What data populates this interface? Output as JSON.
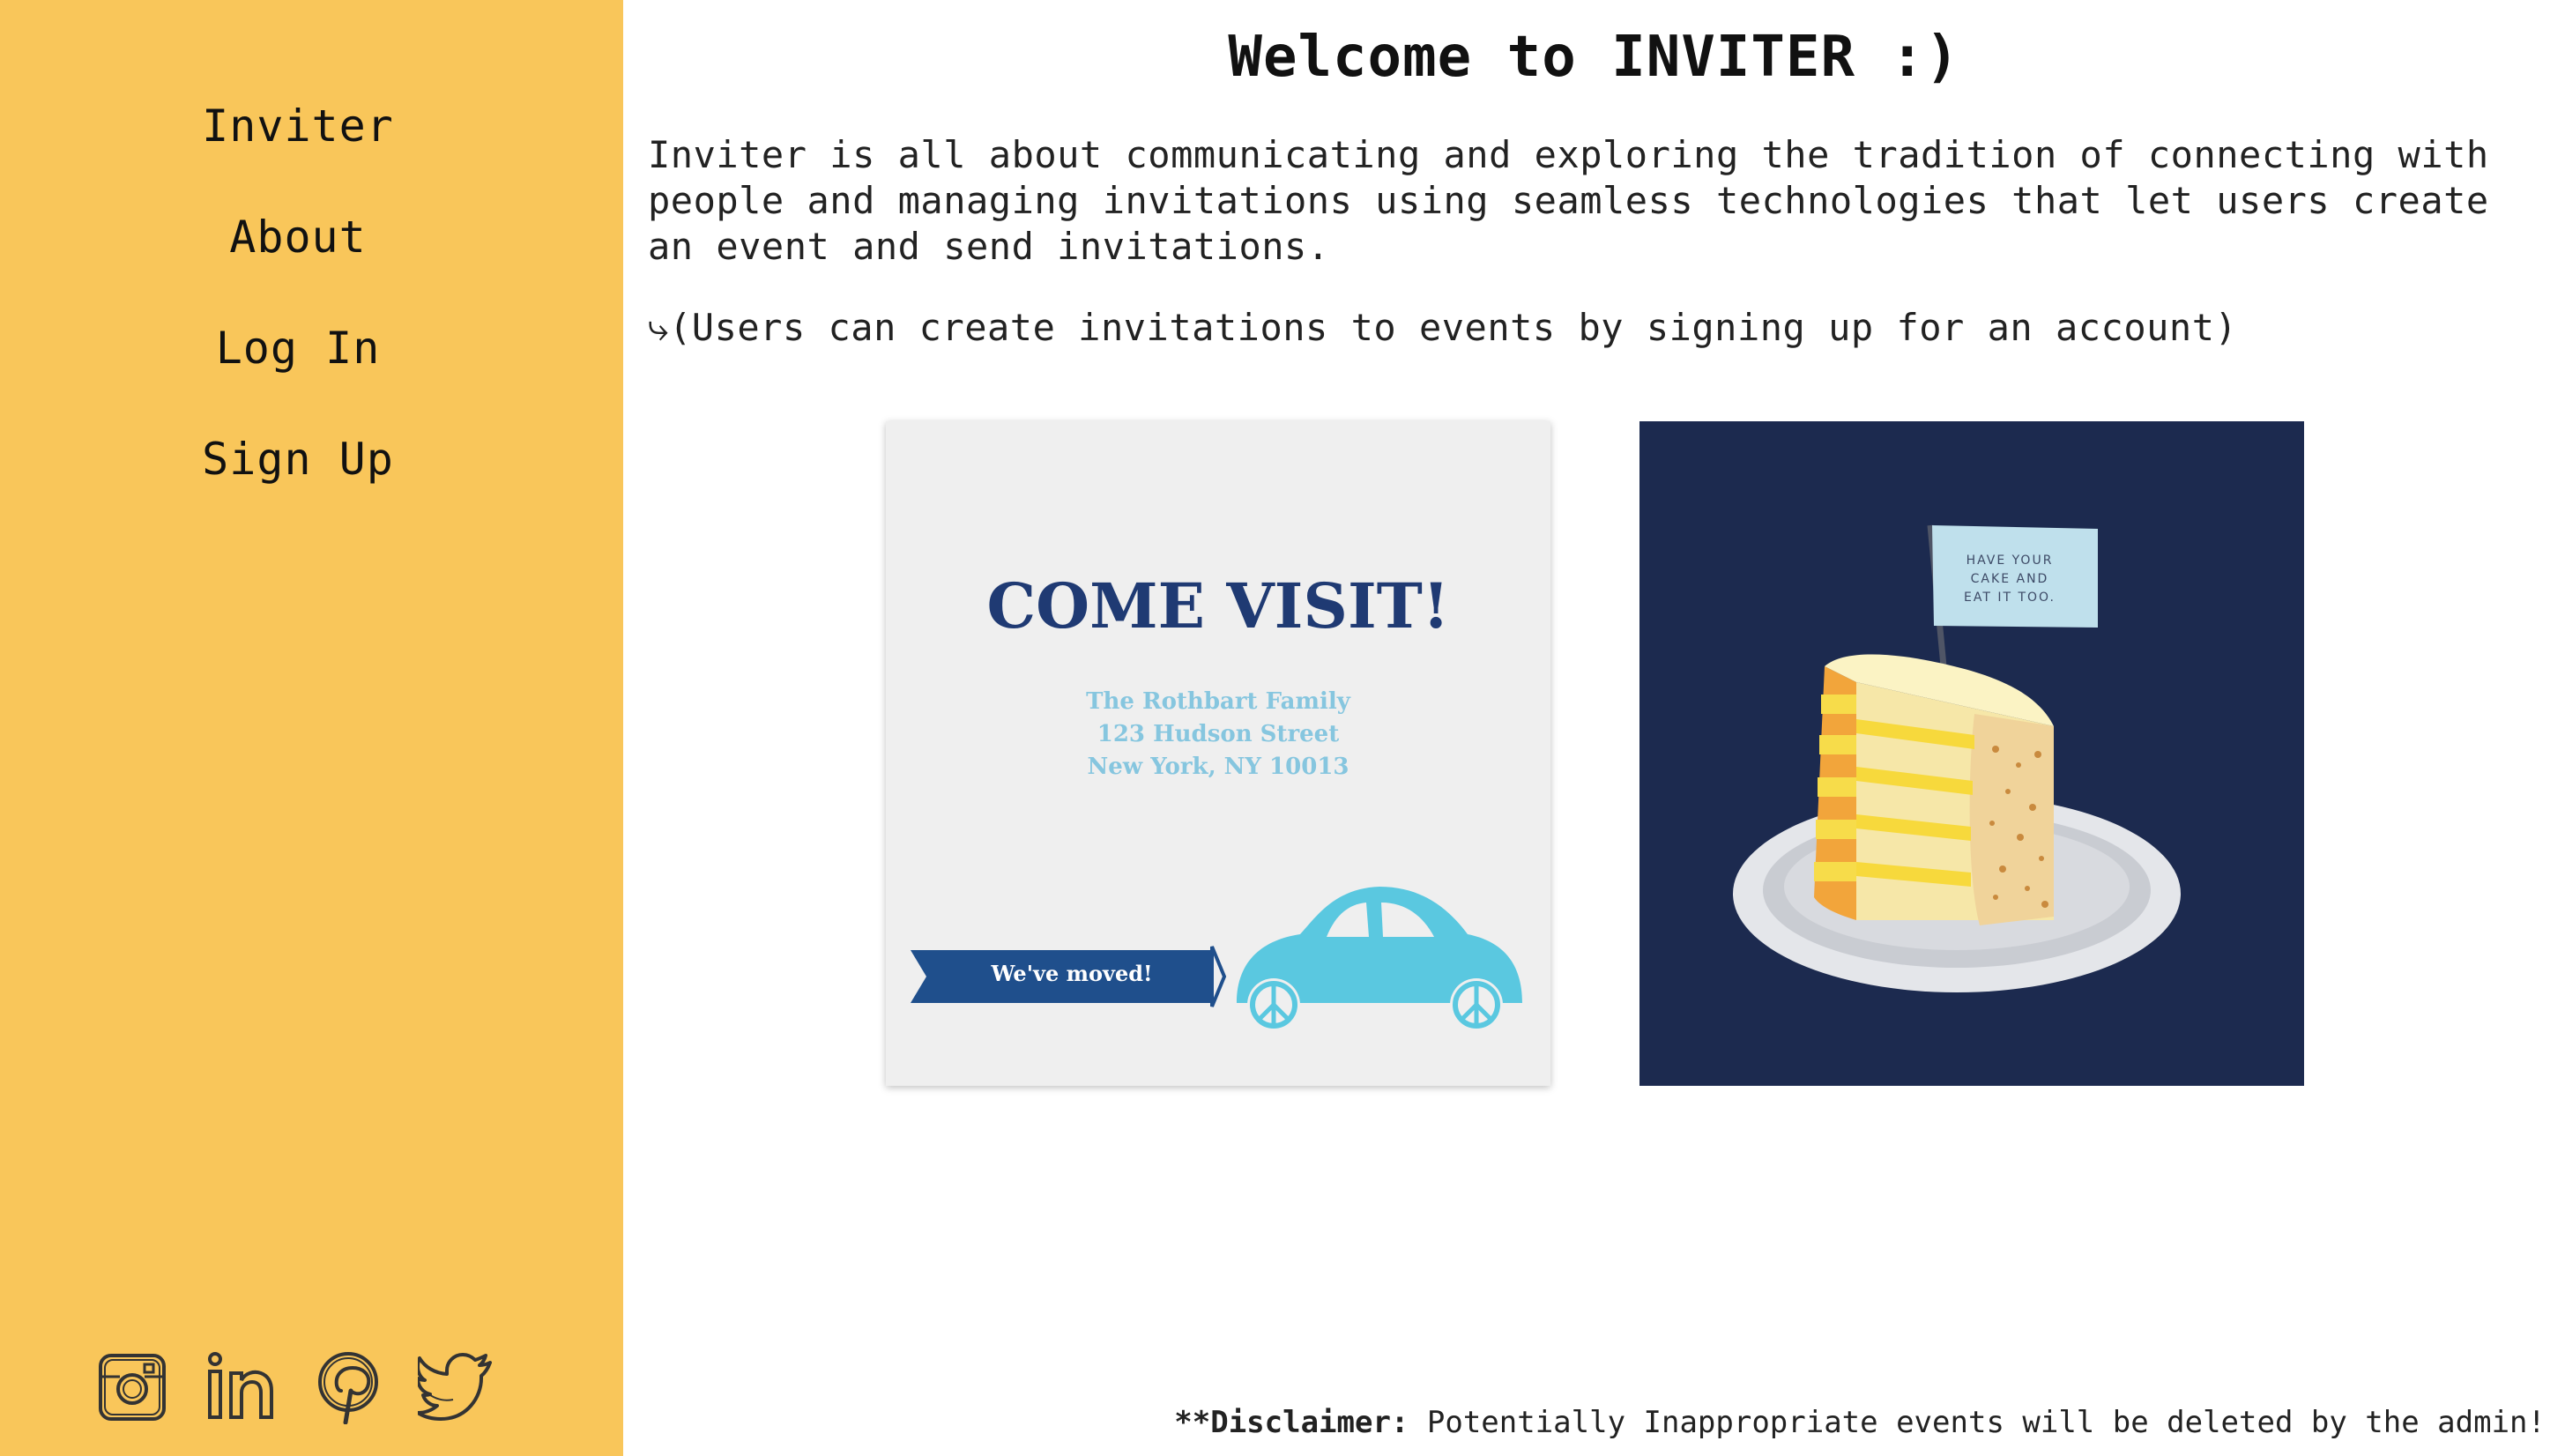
{
  "sidebar": {
    "nav": [
      {
        "label": "Inviter"
      },
      {
        "label": "About"
      },
      {
        "label": "Log In"
      },
      {
        "label": "Sign Up"
      }
    ],
    "social": [
      "instagram-icon",
      "linkedin-icon",
      "pinterest-icon",
      "twitter-icon"
    ],
    "background": "#f9c65a"
  },
  "main": {
    "title": "Welcome to INVITER :)",
    "intro": "Inviter is all about communicating and exploring the tradition of connecting with people and managing invitations using seamless technologies that let users create an event and send invitations.",
    "note": "⤷(Users can create invitations to events by signing up for an account)",
    "cards": {
      "visit": {
        "headline": "COME VISIT!",
        "address": [
          "The Rothbart Family",
          "123 Hudson Street",
          "New York, NY 10013"
        ],
        "banner": "We've moved!"
      },
      "cake": {
        "flag_lines": [
          "HAVE YOUR",
          "CAKE AND",
          "EAT IT TOO."
        ]
      }
    },
    "disclaimer": {
      "label": "**Disclaimer:",
      "text": " Potentially Inappropriate events will be deleted by the admin!"
    }
  }
}
